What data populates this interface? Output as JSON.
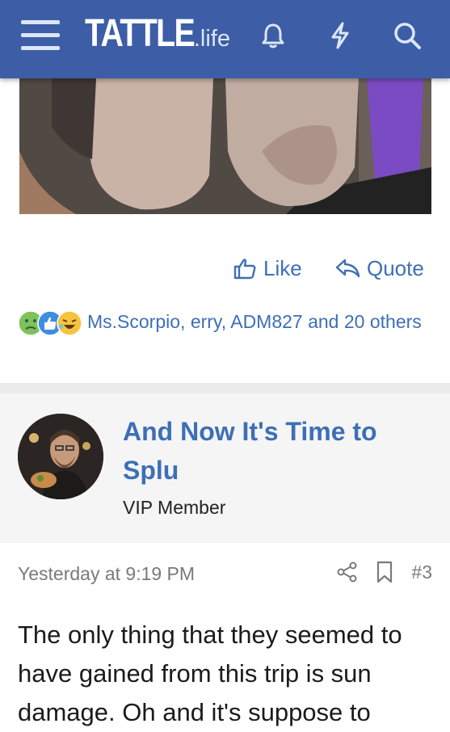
{
  "header": {
    "logo_main": "TATTLE",
    "logo_sub": ".life",
    "icons": [
      "menu-icon",
      "bell-icon",
      "lightning-icon",
      "search-icon"
    ]
  },
  "post_actions": {
    "like_label": "Like",
    "quote_label": "Quote"
  },
  "reactions": {
    "emojis": [
      "sick-face",
      "thumbs-up",
      "laughing-face"
    ],
    "text": "Ms.Scorpio, erry, ADM827 and 20 others"
  },
  "next_post": {
    "author": "And Now It's Time to Splu",
    "role": "VIP Member",
    "timestamp": "Yesterday at 9:19 PM",
    "post_number": "#3",
    "body": "The only thing that they seemed to have gained from this trip is sun damage. Oh and it's suppose to"
  },
  "colors": {
    "header_bg": "#3d5ea6",
    "link": "#3d6fb6"
  }
}
